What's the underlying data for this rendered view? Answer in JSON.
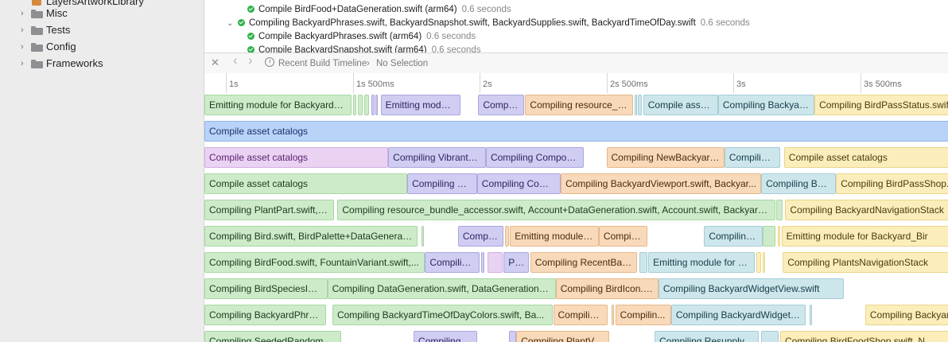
{
  "sidebar": {
    "items": [
      {
        "label": "LayersArtworkLibrary",
        "kind": "package"
      },
      {
        "label": "Misc",
        "kind": "folder"
      },
      {
        "label": "Tests",
        "kind": "folder"
      },
      {
        "label": "Config",
        "kind": "folder"
      },
      {
        "label": "Frameworks",
        "kind": "folder"
      }
    ]
  },
  "log": {
    "lines": [
      {
        "text": "Compile BirdFood+DataGeneration.swift (arm64)",
        "duration": "0.6 seconds",
        "indent": 1,
        "disclosure": false
      },
      {
        "text": "Compiling BackyardPhrases.swift, BackyardSnapshot.swift, BackyardSupplies.swift, BackyardTimeOfDay.swift",
        "duration": "0.6 seconds",
        "indent": 0,
        "disclosure": true
      },
      {
        "text": "Compile BackyardPhrases.swift (arm64)",
        "duration": "0.6 seconds",
        "indent": 1,
        "disclosure": false
      },
      {
        "text": "Compile BackyardSnapshot.swift (arm64)",
        "duration": "0.6 seconds",
        "indent": 1,
        "disclosure": false
      }
    ]
  },
  "toolbar": {
    "close_glyph": "✕",
    "back_glyph": "‹",
    "forward_glyph": "›",
    "timeline_label": "Recent Build Timeline",
    "separator": "›",
    "selection": "No Selection"
  },
  "ruler": {
    "ticks": [
      {
        "label": "1s",
        "seconds": 1.0
      },
      {
        "label": "1s 500ms",
        "seconds": 1.5
      },
      {
        "label": "2s",
        "seconds": 2.0
      },
      {
        "label": "2s 500ms",
        "seconds": 2.5
      },
      {
        "label": "3s",
        "seconds": 3.0
      },
      {
        "label": "3s 500ms",
        "seconds": 3.5
      }
    ]
  },
  "colors": {
    "green": "#cdebc9",
    "purple": "#d0cdf2",
    "peach": "#f8d9b9",
    "teal": "#cde6ec",
    "yellow": "#fbeebb",
    "blue": "#b9d2f7",
    "pink": "#ead2f3"
  },
  "tracks": [
    [
      {
        "label": "Emitting module for BackyardBi...",
        "start": 0.905,
        "end": 1.495,
        "color": "green"
      },
      {
        "label": "",
        "start": 1.5,
        "end": 1.515,
        "color": "green"
      },
      {
        "label": "",
        "start": 1.52,
        "end": 1.54,
        "color": "green"
      },
      {
        "label": "",
        "start": 1.545,
        "end": 1.565,
        "color": "green"
      },
      {
        "label": "",
        "start": 1.575,
        "end": 1.585,
        "color": "purple"
      },
      {
        "label": "",
        "start": 1.59,
        "end": 1.6,
        "color": "purple"
      },
      {
        "label": "Emitting modul...",
        "start": 1.61,
        "end": 1.925,
        "color": "purple"
      },
      {
        "label": "Compil...",
        "start": 1.995,
        "end": 2.175,
        "color": "purple"
      },
      {
        "label": "Compiling resource_b...",
        "start": 2.18,
        "end": 2.605,
        "color": "peach"
      },
      {
        "label": "",
        "start": 2.61,
        "end": 2.62,
        "color": "teal"
      },
      {
        "label": "",
        "start": 2.625,
        "end": 2.64,
        "color": "teal"
      },
      {
        "label": "Compile asset...",
        "start": 2.645,
        "end": 2.94,
        "color": "teal"
      },
      {
        "label": "Compiling Backyard...",
        "start": 2.94,
        "end": 3.32,
        "color": "teal"
      },
      {
        "label": "Compiling BirdPassStatus.swift",
        "start": 3.32,
        "end": 3.95,
        "color": "yellow"
      }
    ],
    [
      {
        "label": "Compile asset catalogs",
        "start": 0.905,
        "end": 3.95,
        "color": "blue"
      }
    ],
    [
      {
        "label": "Compile asset catalogs",
        "start": 0.905,
        "end": 1.64,
        "color": "pink"
      },
      {
        "label": "Compiling VibrantB...",
        "start": 1.64,
        "end": 2.025,
        "color": "purple"
      },
      {
        "label": "Compiling Compos...",
        "start": 2.025,
        "end": 2.41,
        "color": "purple"
      },
      {
        "label": "Compiling NewBackyard...",
        "start": 2.5,
        "end": 2.965,
        "color": "peach"
      },
      {
        "label": "Compiling...",
        "start": 2.965,
        "end": 3.185,
        "color": "teal"
      },
      {
        "label": "Compile asset catalogs",
        "start": 3.2,
        "end": 3.95,
        "color": "yellow"
      }
    ],
    [
      {
        "label": "Compile asset catalogs",
        "start": 0.905,
        "end": 1.715,
        "color": "green"
      },
      {
        "label": "Compiling Fl...",
        "start": 1.715,
        "end": 1.99,
        "color": "purple"
      },
      {
        "label": "Compiling Comp...",
        "start": 1.99,
        "end": 2.32,
        "color": "purple"
      },
      {
        "label": "Compiling BackyardViewport.swift, Backyar...",
        "start": 2.32,
        "end": 3.11,
        "color": "peach"
      },
      {
        "label": "Compiling Bac...",
        "start": 3.11,
        "end": 3.405,
        "color": "teal"
      },
      {
        "label": "Compiling BirdPassShop.swift",
        "start": 3.405,
        "end": 3.95,
        "color": "yellow"
      }
    ],
    [
      {
        "label": "Compiling PlantPart.swift, P...",
        "start": 0.905,
        "end": 1.425,
        "color": "green"
      },
      {
        "label": "Compiling resource_bundle_accessor.swift, Account+DataGeneration.swift, Account.swift, Backyard+D...",
        "start": 1.44,
        "end": 3.165,
        "color": "green"
      },
      {
        "label": "",
        "start": 3.17,
        "end": 3.195,
        "color": "green"
      },
      {
        "label": "Compiling BackyardNavigationStack",
        "start": 3.205,
        "end": 3.95,
        "color": "yellow"
      }
    ],
    [
      {
        "label": "Compiling Bird.swift, BirdPalette+DataGeneratio...",
        "start": 0.905,
        "end": 1.755,
        "color": "green"
      },
      {
        "label": "",
        "start": 1.77,
        "end": 1.78,
        "color": "green"
      },
      {
        "label": "Compili...",
        "start": 1.915,
        "end": 2.095,
        "color": "purple"
      },
      {
        "label": "",
        "start": 2.1,
        "end": 2.115,
        "color": "peach"
      },
      {
        "label": "Emitting module f...",
        "start": 2.12,
        "end": 2.47,
        "color": "peach"
      },
      {
        "label": "Compili...",
        "start": 2.47,
        "end": 2.66,
        "color": "peach"
      },
      {
        "label": "Compiling...",
        "start": 2.885,
        "end": 3.115,
        "color": "teal"
      },
      {
        "label": "",
        "start": 3.115,
        "end": 3.165,
        "color": "green"
      },
      {
        "label": "",
        "start": 3.175,
        "end": 3.185,
        "color": "yellow"
      },
      {
        "label": "Emitting module for Backyard_Bir",
        "start": 3.19,
        "end": 3.95,
        "color": "yellow"
      }
    ],
    [
      {
        "label": "Compiling BirdFood.swift, FountainVariant.swift,...",
        "start": 0.905,
        "end": 1.785,
        "color": "green"
      },
      {
        "label": "Compilin...",
        "start": 1.785,
        "end": 2.0,
        "color": "purple"
      },
      {
        "label": "",
        "start": 2.005,
        "end": 2.02,
        "color": "purple"
      },
      {
        "label": "",
        "start": 2.03,
        "end": 2.09,
        "color": "pink"
      },
      {
        "label": "Pro...",
        "start": 2.095,
        "end": 2.195,
        "color": "purple"
      },
      {
        "label": "Compiling RecentBack...",
        "start": 2.2,
        "end": 2.62,
        "color": "peach"
      },
      {
        "label": "",
        "start": 2.63,
        "end": 2.66,
        "color": "teal"
      },
      {
        "label": "Emitting module for Widg...",
        "start": 2.665,
        "end": 3.085,
        "color": "teal"
      },
      {
        "label": "",
        "start": 3.09,
        "end": 3.11,
        "color": "yellow"
      },
      {
        "label": "",
        "start": 3.115,
        "end": 3.125,
        "color": "yellow"
      },
      {
        "label": "Compiling PlantsNavigationStack",
        "start": 3.195,
        "end": 3.95,
        "color": "yellow"
      }
    ],
    [
      {
        "label": "Compiling BirdSpeciesInf...",
        "start": 0.905,
        "end": 1.4,
        "color": "green"
      },
      {
        "label": "Compiling DataGeneration.swift, DataGenerationOp...",
        "start": 1.4,
        "end": 2.3,
        "color": "green"
      },
      {
        "label": "Compiling BirdIcon.s...",
        "start": 2.3,
        "end": 2.705,
        "color": "peach"
      },
      {
        "label": "Compiling BackyardWidgetView.swift",
        "start": 2.705,
        "end": 3.435,
        "color": "teal"
      }
    ],
    [
      {
        "label": "Compiling BackyardPhras...",
        "start": 0.905,
        "end": 1.395,
        "color": "green"
      },
      {
        "label": "Compiling BackyardTimeOfDayColors.swift, Ba...",
        "start": 1.42,
        "end": 2.29,
        "color": "green"
      },
      {
        "label": "Compiling...",
        "start": 2.29,
        "end": 2.505,
        "color": "peach"
      },
      {
        "label": "",
        "start": 2.52,
        "end": 2.53,
        "color": "peach"
      },
      {
        "label": "Compilin...",
        "start": 2.535,
        "end": 2.755,
        "color": "peach"
      },
      {
        "label": "Compiling BackyardWidgetI...",
        "start": 2.755,
        "end": 3.285,
        "color": "teal"
      },
      {
        "label": "",
        "start": 3.3,
        "end": 3.31,
        "color": "teal"
      },
      {
        "label": "Compiling Backyar",
        "start": 3.52,
        "end": 3.95,
        "color": "yellow"
      }
    ],
    [
      {
        "label": "Compiling SeededRandomGe...",
        "start": 0.905,
        "end": 1.455,
        "color": "green"
      },
      {
        "label": "Compiling...",
        "start": 1.74,
        "end": 1.99,
        "color": "purple"
      },
      {
        "label": "",
        "start": 2.115,
        "end": 2.145,
        "color": "purple"
      },
      {
        "label": "Compiling PlantVie...",
        "start": 2.145,
        "end": 2.51,
        "color": "peach"
      },
      {
        "label": "Compiling ResupplyBac...",
        "start": 2.69,
        "end": 3.1,
        "color": "teal"
      },
      {
        "label": "",
        "start": 3.11,
        "end": 3.18,
        "color": "teal"
      },
      {
        "label": "Compiling BirdFoodShop.swift, N",
        "start": 3.185,
        "end": 3.95,
        "color": "yellow"
      }
    ]
  ]
}
